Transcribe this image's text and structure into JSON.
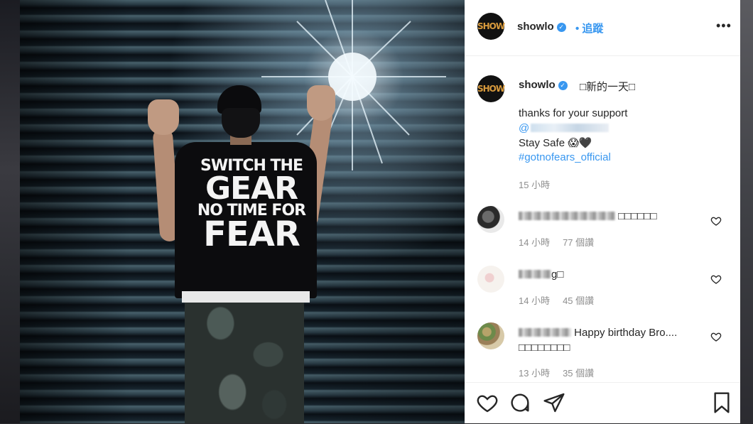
{
  "header": {
    "username": "showlo",
    "follow_label": "• 追蹤",
    "more_label": "•••",
    "avatar_text": "SHOW"
  },
  "caption": {
    "username": "showlo",
    "title": "□新的一天□",
    "line1": "thanks for your support",
    "mention_prefix": "@",
    "line3": "Stay Safe 😱🖤",
    "hashtag": "#gotnofears_official",
    "time": "15 小時"
  },
  "comments": [
    {
      "text": "□□□□□□",
      "time": "14 小時",
      "likes": "77 個讚"
    },
    {
      "text": "g□",
      "time": "14 小時",
      "likes": "45 個讚"
    },
    {
      "text": "Happy birthday Bro....",
      "text2": "□□□□□□□□",
      "time": "13 小時",
      "likes": "35 個讚"
    }
  ],
  "photo": {
    "shirt_line1": "SWITCH THE",
    "shirt_line2": "GEAR",
    "shirt_line3": "NO TIME FOR",
    "shirt_line4": "FEAR"
  },
  "icons": {
    "verified": "verified-badge-icon",
    "like": "heart-icon",
    "comment": "comment-icon",
    "share": "paper-plane-icon",
    "save": "bookmark-icon"
  },
  "colors": {
    "link_blue": "#3897f0",
    "text": "#262626",
    "muted": "#8e8e8e"
  }
}
